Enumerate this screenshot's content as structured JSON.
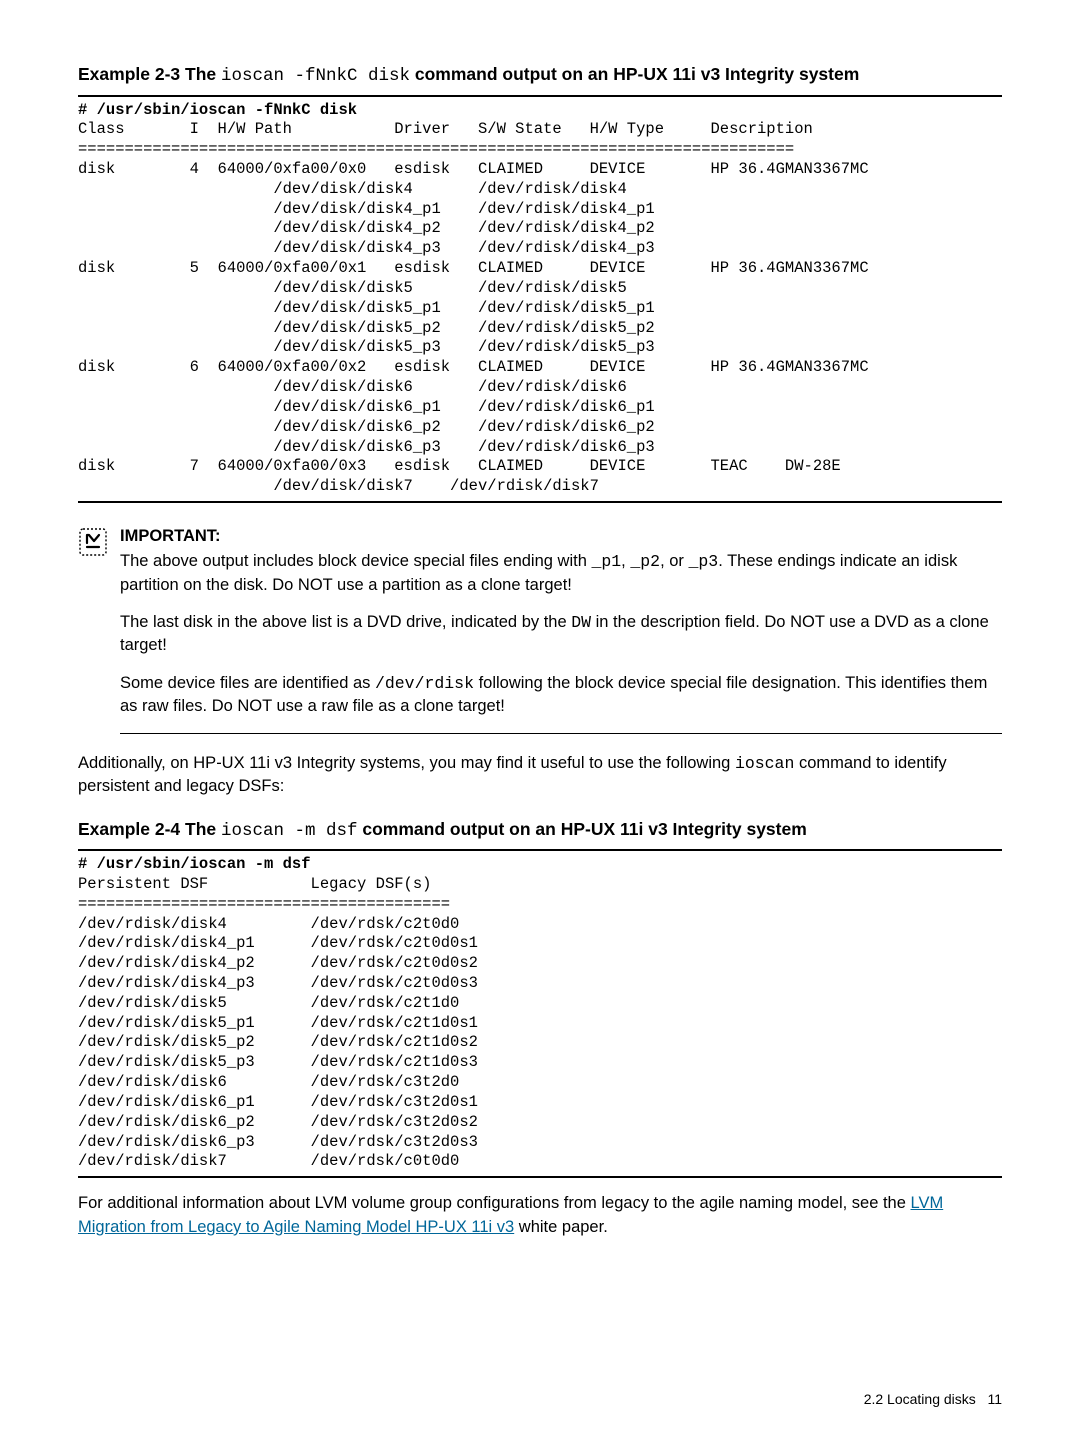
{
  "example1_title_prefix": "Example 2-3 The ",
  "example1_title_code": "ioscan -fNnkC disk",
  "example1_title_suffix": " command output on an HP-UX 11i v3 Integrity system",
  "cmd1": "# /usr/sbin/ioscan -fNnkC disk",
  "hdr1": "Class       I  H/W Path           Driver   S/W State   H/W Type     Description",
  "sep1": "=============================================================================",
  "r1": "disk        4  64000/0xfa00/0x0   esdisk   CLAIMED     DEVICE       HP 36.4GMAN3367MC",
  "r1a": "                     /dev/disk/disk4       /dev/rdisk/disk4",
  "r1b": "                     /dev/disk/disk4_p1    /dev/rdisk/disk4_p1",
  "r1c": "                     /dev/disk/disk4_p2    /dev/rdisk/disk4_p2",
  "r1d": "                     /dev/disk/disk4_p3    /dev/rdisk/disk4_p3",
  "r2": "disk        5  64000/0xfa00/0x1   esdisk   CLAIMED     DEVICE       HP 36.4GMAN3367MC",
  "r2a": "                     /dev/disk/disk5       /dev/rdisk/disk5",
  "r2b": "                     /dev/disk/disk5_p1    /dev/rdisk/disk5_p1",
  "r2c": "                     /dev/disk/disk5_p2    /dev/rdisk/disk5_p2",
  "r2d": "                     /dev/disk/disk5_p3    /dev/rdisk/disk5_p3",
  "r3": "disk        6  64000/0xfa00/0x2   esdisk   CLAIMED     DEVICE       HP 36.4GMAN3367MC",
  "r3a": "                     /dev/disk/disk6       /dev/rdisk/disk6",
  "r3b": "                     /dev/disk/disk6_p1    /dev/rdisk/disk6_p1",
  "r3c": "                     /dev/disk/disk6_p2    /dev/rdisk/disk6_p2",
  "r3d": "                     /dev/disk/disk6_p3    /dev/rdisk/disk6_p3",
  "r4": "disk        7  64000/0xfa00/0x3   esdisk   CLAIMED     DEVICE       TEAC    DW-28E",
  "r4a": "                     /dev/disk/disk7    /dev/rdisk/disk7",
  "important_label": "IMPORTANT:",
  "imp_p1_a": "The above output includes block device special files ending with ",
  "imp_p1_c1": "_p1",
  "imp_p1_b": ", ",
  "imp_p1_c2": "_p2",
  "imp_p1_c": ", or ",
  "imp_p1_c3": "_p3",
  "imp_p1_d": ". These endings indicate an idisk partition on the disk. Do NOT use a partition as a clone target!",
  "imp_p2_a": "The last disk in the above list is a DVD drive, indicated by the ",
  "imp_p2_c1": "DW",
  "imp_p2_b": " in the description field. Do NOT use a DVD as a clone target!",
  "imp_p3_a": "Some device files are identified as ",
  "imp_p3_c1": "/dev/rdisk",
  "imp_p3_b": " following the block device special file designation. This identifies them as raw files. Do NOT use a raw file as a clone target!",
  "body_p1_a": "Additionally, on HP-UX 11i v3 Integrity systems, you may find it useful to use the following ",
  "body_p1_c1": "ioscan",
  "body_p1_b": " command to identify persistent and legacy DSFs:",
  "example2_title_prefix": "Example 2-4 The ",
  "example2_title_code": "ioscan -m dsf",
  "example2_title_suffix": " command output on an HP-UX 11i v3 Integrity system",
  "cmd2": "# /usr/sbin/ioscan -m dsf",
  "hdr2": "Persistent DSF           Legacy DSF(s)",
  "sep2": "========================================",
  "t01": "/dev/rdisk/disk4         /dev/rdsk/c2t0d0",
  "t02": "/dev/rdisk/disk4_p1      /dev/rdsk/c2t0d0s1",
  "t03": "/dev/rdisk/disk4_p2      /dev/rdsk/c2t0d0s2",
  "t04": "/dev/rdisk/disk4_p3      /dev/rdsk/c2t0d0s3",
  "t05": "/dev/rdisk/disk5         /dev/rdsk/c2t1d0",
  "t06": "/dev/rdisk/disk5_p1      /dev/rdsk/c2t1d0s1",
  "t07": "/dev/rdisk/disk5_p2      /dev/rdsk/c2t1d0s2",
  "t08": "/dev/rdisk/disk5_p3      /dev/rdsk/c2t1d0s3",
  "t09": "/dev/rdisk/disk6         /dev/rdsk/c3t2d0",
  "t10": "/dev/rdisk/disk6_p1      /dev/rdsk/c3t2d0s1",
  "t11": "/dev/rdisk/disk6_p2      /dev/rdsk/c3t2d0s2",
  "t12": "/dev/rdisk/disk6_p3      /dev/rdsk/c3t2d0s3",
  "t13": "/dev/rdisk/disk7         /dev/rdsk/c0t0d0",
  "final_p_a": "For additional information about LVM volume group configurations from legacy to the agile naming model, see the ",
  "final_link": "LVM Migration from Legacy to Agile Naming Model HP-UX 11i v3",
  "final_p_b": " white paper.",
  "footer_text": "2.2 Locating disks",
  "page_num": "11"
}
